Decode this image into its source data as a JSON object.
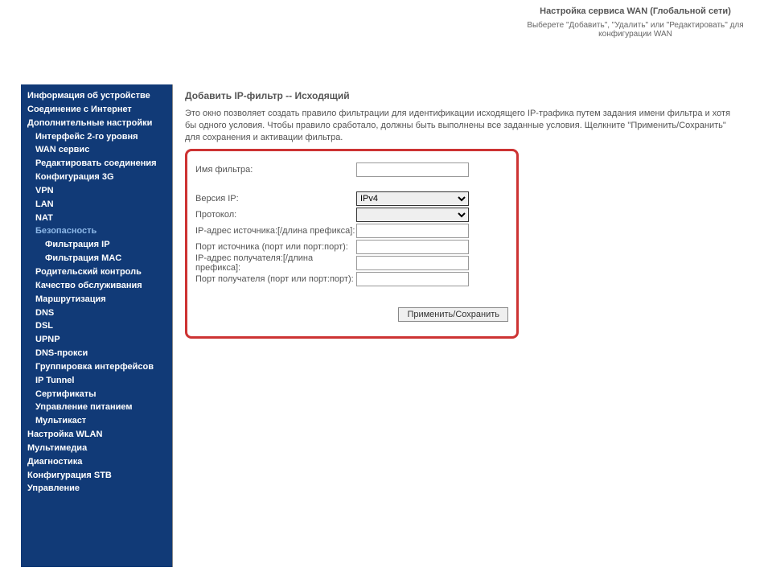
{
  "header": {
    "title": "Настройка сервиса WAN (Глобальной сети)",
    "subtitle": "Выберете \"Добавить\", \"Удалить\" или \"Редактировать\" для конфигурации WAN"
  },
  "sidebar": {
    "groups": [
      {
        "label": "Информация об устройстве",
        "level": 0
      },
      {
        "label": "Соединение с Интернет",
        "level": 0
      },
      {
        "label": "Дополнительные настройки",
        "level": 0
      },
      {
        "label": "Интерфейс 2-го уровня",
        "level": 1
      },
      {
        "label": "WAN сервис",
        "level": 1
      },
      {
        "label": "Редактировать соединения",
        "level": 1
      },
      {
        "label": "Конфигурация 3G",
        "level": 1
      },
      {
        "label": "VPN",
        "level": 1
      },
      {
        "label": "LAN",
        "level": 1
      },
      {
        "label": "NAT",
        "level": 1
      },
      {
        "label": "Безопасность",
        "level": 1,
        "active": true
      },
      {
        "label": "Фильтрация IP",
        "level": 2
      },
      {
        "label": "Фильтрация MAC",
        "level": 2
      },
      {
        "label": "Родительский контроль",
        "level": 1
      },
      {
        "label": "Качество обслуживания",
        "level": 1
      },
      {
        "label": "Маршрутизация",
        "level": 1
      },
      {
        "label": "DNS",
        "level": 1
      },
      {
        "label": "DSL",
        "level": 1
      },
      {
        "label": "UPNP",
        "level": 1
      },
      {
        "label": "DNS-прокси",
        "level": 1
      },
      {
        "label": "Группировка интерфейсов",
        "level": 1
      },
      {
        "label": "IP Tunnel",
        "level": 1
      },
      {
        "label": "Сертификаты",
        "level": 1
      },
      {
        "label": "Управление питанием",
        "level": 1
      },
      {
        "label": "Мультикаст",
        "level": 1
      },
      {
        "label": "Настройка WLAN",
        "level": 0
      },
      {
        "label": "Мультимедиа",
        "level": 0
      },
      {
        "label": "Диагностика",
        "level": 0
      },
      {
        "label": "Конфигурация STB",
        "level": 0
      },
      {
        "label": "Управление",
        "level": 0
      }
    ]
  },
  "content": {
    "title": "Добавить IP-фильтр -- Исходящий",
    "description": "Это окно позволяет создать правило фильтрации для идентификации исходящего IP-трафика путем задания имени фильтра и хотя бы одного условия. Чтобы правило сработало, должны быть выполнены все заданные условия. Щелкните \"Применить/Сохранить\" для сохранения и активации фильтра.",
    "form": {
      "filter_name_label": "Имя фильтра:",
      "filter_name_value": "",
      "ip_version_label": "Версия IP:",
      "ip_version_value": "IPv4",
      "protocol_label": "Протокол:",
      "protocol_value": "",
      "src_ip_label": "IP-адрес источника:[/длина префикса]:",
      "src_ip_value": "",
      "src_port_label": "Порт источника (порт или порт:порт):",
      "src_port_value": "",
      "dst_ip_label": "IP-адрес получателя:[/длина префикса]:",
      "dst_ip_value": "",
      "dst_port_label": "Порт получателя (порт или порт:порт):",
      "dst_port_value": "",
      "submit_label": "Применить/Сохранить"
    }
  }
}
